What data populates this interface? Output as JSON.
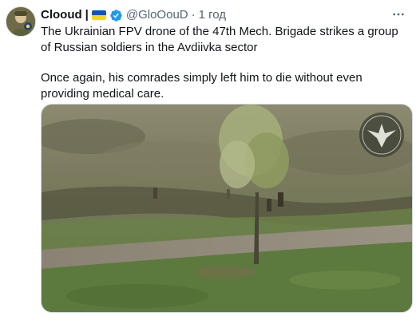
{
  "tweet": {
    "display_name": "Clooud",
    "separator": "|",
    "handle": "@GloOouD",
    "dot": "·",
    "time": "1 год",
    "paragraphs": [
      "The Ukrainian FPV drone of the 47th Mech. Brigade strikes a group of Russian soldiers in the Avdiivka sector",
      "Once again, his comrades simply left him to die without even providing medical care."
    ]
  },
  "icons": {
    "more": "more-horizontal-icon",
    "verified": "verified-badge-icon",
    "flag": "ukraine-flag-icon",
    "watermark": "brigade-emblem-icon"
  },
  "colors": {
    "flag_blue": "#0057b7",
    "flag_yellow": "#ffd700",
    "verified_blue": "#1d9bf0",
    "text": "#0f1419",
    "secondary": "#536471"
  }
}
